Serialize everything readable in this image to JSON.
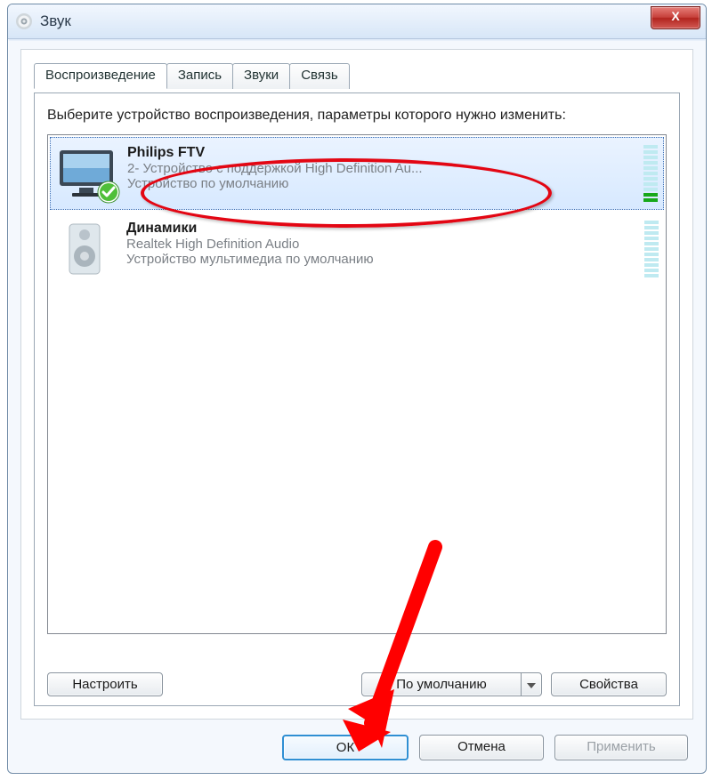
{
  "window": {
    "title": "Звук",
    "close_label": "X"
  },
  "tabs": [
    {
      "label": "Воспроизведение",
      "active": true
    },
    {
      "label": "Запись",
      "active": false
    },
    {
      "label": "Звуки",
      "active": false
    },
    {
      "label": "Связь",
      "active": false
    }
  ],
  "instruction": "Выберите устройство воспроизведения, параметры которого нужно изменить:",
  "devices": [
    {
      "name": "Philips FTV",
      "desc": "2- Устройство с поддержкой High Definition Au...",
      "status": "Устройство по умолчанию",
      "selected": true,
      "default_check": true
    },
    {
      "name": "Динамики",
      "desc": "Realtek High Definition Audio",
      "status": "Устройство мультимедиа по умолчанию",
      "selected": false,
      "default_check": false
    }
  ],
  "panel_buttons": {
    "configure": "Настроить",
    "set_default": "По умолчанию",
    "properties": "Свойства"
  },
  "dialog_buttons": {
    "ok": "ОК",
    "cancel": "Отмена",
    "apply": "Применить"
  }
}
